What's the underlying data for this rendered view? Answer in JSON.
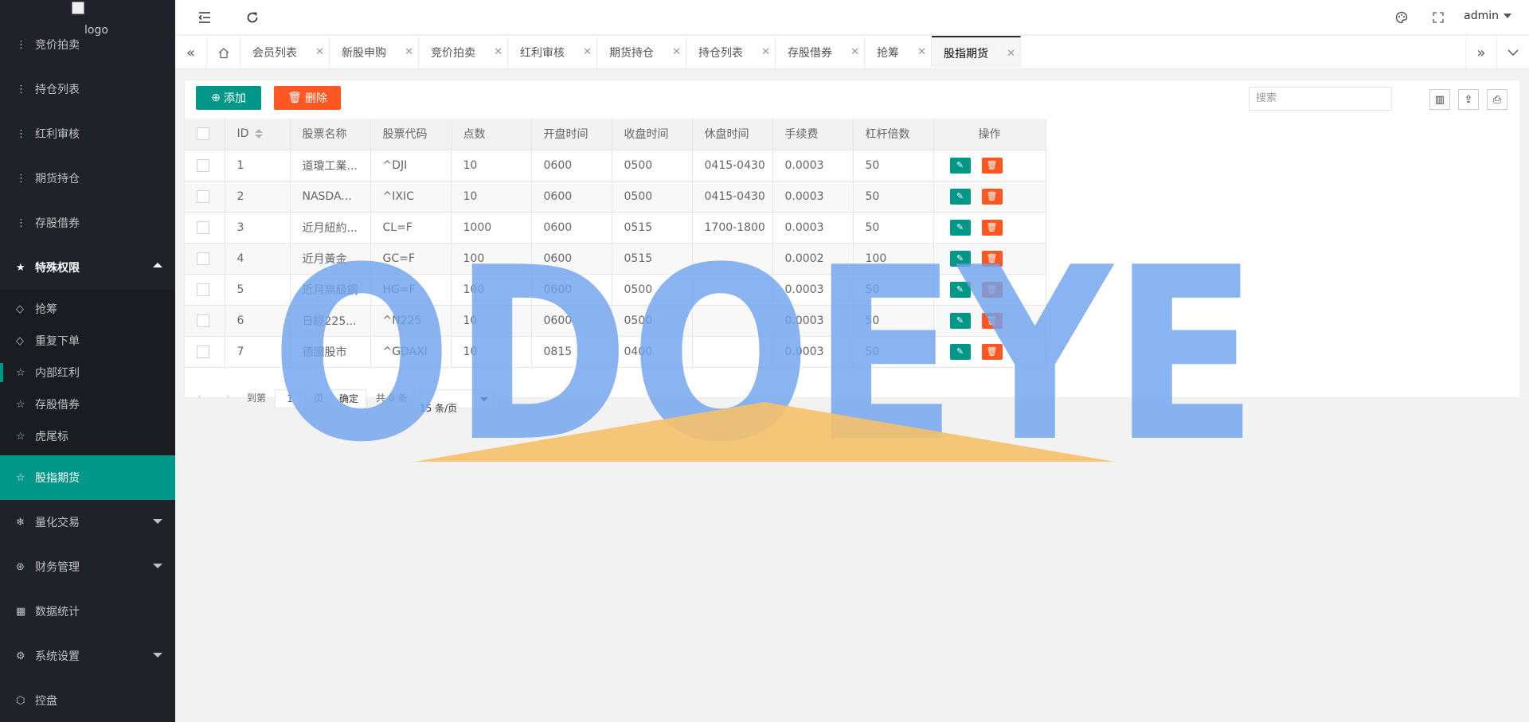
{
  "sidebar": {
    "logo_alt": "logo",
    "items": [
      {
        "label": "竞价拍卖",
        "icon": "dots-vertical-icon"
      },
      {
        "label": "持仓列表",
        "icon": "dots-vertical-icon"
      },
      {
        "label": "红利审核",
        "icon": "dots-vertical-icon"
      },
      {
        "label": "期货持仓",
        "icon": "dots-vertical-icon"
      },
      {
        "label": "存股借券",
        "icon": "dots-vertical-icon"
      }
    ],
    "special": {
      "label": "特殊权限",
      "icon": "star-filled-icon"
    },
    "special_children": [
      {
        "label": "抢筹",
        "icon": "diamond-icon"
      },
      {
        "label": "重复下单",
        "icon": "diamond-icon"
      },
      {
        "label": "内部红利",
        "icon": "star-outline-icon"
      },
      {
        "label": "存股借券",
        "icon": "star-outline-icon"
      },
      {
        "label": "虎尾标",
        "icon": "star-outline-icon"
      }
    ],
    "active": {
      "label": "股指期货",
      "icon": "star-outline-icon"
    },
    "bottom": [
      {
        "label": "量化交易",
        "icon": "snowflake-icon"
      },
      {
        "label": "财务管理",
        "icon": "yen-icon"
      },
      {
        "label": "数据统计",
        "icon": "calendar-icon"
      },
      {
        "label": "系统设置",
        "icon": "gear-icon"
      },
      {
        "label": "控盘",
        "icon": "cube-icon"
      }
    ]
  },
  "header": {
    "user": "admin"
  },
  "tabs": [
    {
      "label": "会员列表"
    },
    {
      "label": "新股申购"
    },
    {
      "label": "竞价拍卖"
    },
    {
      "label": "红利审核"
    },
    {
      "label": "期货持仓"
    },
    {
      "label": "持仓列表"
    },
    {
      "label": "存股借券"
    },
    {
      "label": "抢筹"
    },
    {
      "label": "股指期货"
    }
  ],
  "toolbar": {
    "add_label": "添加",
    "delete_label": "删除",
    "search_placeholder": "搜索"
  },
  "table": {
    "columns": [
      "ID",
      "股票名称",
      "股票代码",
      "点数",
      "开盘时间",
      "收盘时间",
      "休盘时间",
      "手续费",
      "杠杆倍数",
      "操作"
    ],
    "rows": [
      [
        "1",
        "道瓊工業...",
        "^DJI",
        "10",
        "0600",
        "0500",
        "0415-0430",
        "0.0003",
        "50"
      ],
      [
        "2",
        "NASDA...",
        "^IXIC",
        "10",
        "0600",
        "0500",
        "0415-0430",
        "0.0003",
        "50"
      ],
      [
        "3",
        "近月紐約...",
        "CL=F",
        "1000",
        "0600",
        "0515",
        "1700-1800",
        "0.0003",
        "50"
      ],
      [
        "4",
        "近月黃金",
        "GC=F",
        "100",
        "0600",
        "0515",
        "",
        "0.0002",
        "100"
      ],
      [
        "5",
        "近月高級銅",
        "HG=F",
        "100",
        "0600",
        "0500",
        "",
        "0.0003",
        "50"
      ],
      [
        "6",
        "日經225...",
        "^N225",
        "10",
        "0600",
        "0500",
        "",
        "0.0003",
        "50"
      ],
      [
        "7",
        "德國股市",
        "^GDAXI",
        "10",
        "0815",
        "0400",
        "",
        "0.0003",
        "50"
      ]
    ]
  },
  "pager": {
    "goto": "到第",
    "page": "1",
    "page_unit": "页",
    "confirm": "确定",
    "total": "共 0 条",
    "per_page": "15 条/页"
  },
  "watermark": {
    "text": "ODOEYE",
    "color": "#6fa3ec",
    "accent": "#f5c06a"
  }
}
